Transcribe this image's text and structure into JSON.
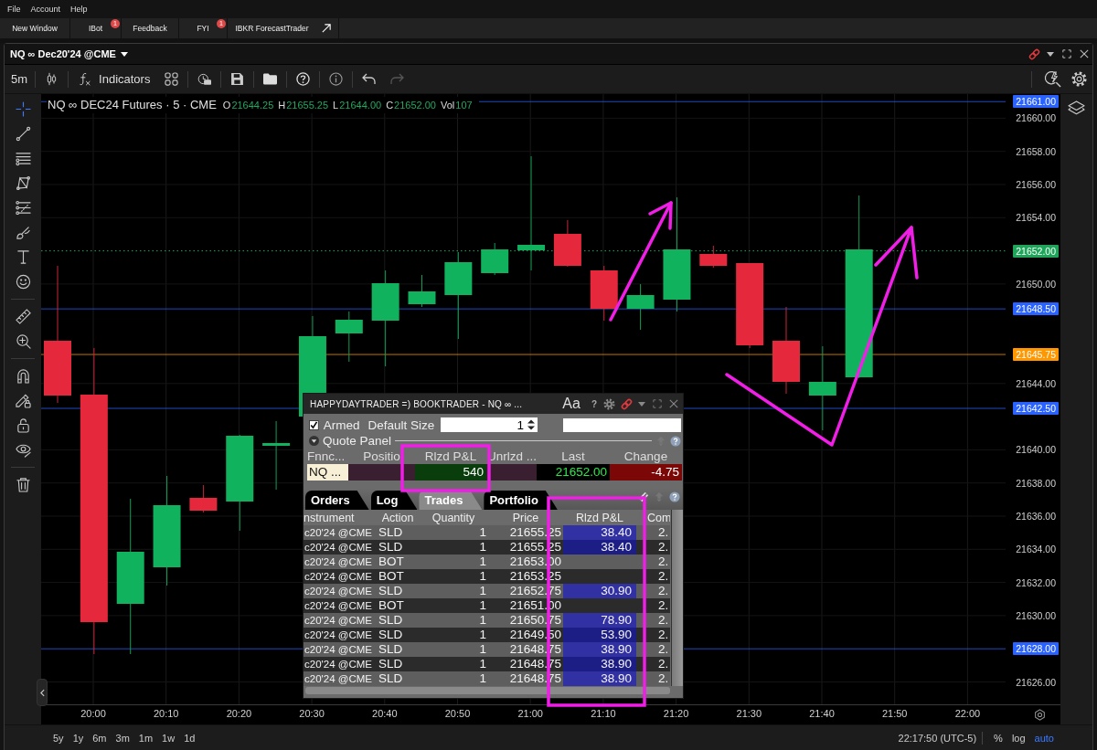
{
  "menu_bar": [
    {
      "label": "File"
    },
    {
      "label": "Account"
    },
    {
      "label": "Help"
    }
  ],
  "app_tabs": [
    {
      "label": "New Window",
      "kind": "plain"
    },
    {
      "label": "IBot",
      "kind": "plain",
      "badge": "1"
    },
    {
      "label": "Feedback",
      "kind": "plain"
    },
    {
      "label": "FYI",
      "kind": "plain",
      "badge": "1"
    },
    {
      "label": "IBKR ForecastTrader",
      "kind": "external"
    }
  ],
  "chart_window": {
    "title": "NQ ∞ Dec20'24 @CME",
    "toolbar": {
      "interval": "5m",
      "indicators": "Indicators",
      "undo": {
        "disabled": false
      },
      "redo": {
        "disabled": true
      }
    },
    "drawing_tools": [
      {
        "selected": true
      },
      {
        "selected": false
      },
      {
        "selected": false
      },
      {
        "selected": false
      },
      {
        "selected": false
      },
      {
        "selected": false
      },
      {
        "selected": false
      },
      {
        "selected": false
      },
      {
        "selected": false
      },
      {
        "selected": false
      },
      {
        "selected": false
      },
      {
        "selected": false
      },
      {
        "selected": false
      },
      {
        "selected": false
      },
      {
        "selected": false
      }
    ],
    "legend": {
      "symbol": "NQ ∞ DEC24 Futures · 5 · CME",
      "fields": [
        {
          "label": "O",
          "value": "21644.25"
        },
        {
          "label": "H",
          "value": "21655.25"
        },
        {
          "label": "L",
          "value": "21644.00"
        },
        {
          "label": "C",
          "value": "21652.00"
        },
        {
          "label": "Vol",
          "value": "107"
        }
      ]
    },
    "price_ticks": [
      "21660.00",
      "21658.00",
      "21656.00",
      "21654.00",
      "21650.00",
      "21644.00",
      "21640.00",
      "21638.00",
      "21636.00",
      "21634.00",
      "21632.00",
      "21630.00",
      "21626.00"
    ],
    "price_markers": [
      {
        "label": "21661.00",
        "color": "#2962ff",
        "kind": "level"
      },
      {
        "label": "21652.00",
        "color": "#1ea55a",
        "kind": "last"
      },
      {
        "label": "21648.50",
        "color": "#2962ff",
        "kind": "level"
      },
      {
        "label": "21645.75",
        "color": "#ff9800",
        "kind": "level"
      },
      {
        "label": "21642.50",
        "color": "#2962ff",
        "kind": "level"
      },
      {
        "label": "21628.00",
        "color": "#2962ff",
        "kind": "level"
      }
    ],
    "time_axis": [
      "20:00",
      "20:10",
      "20:20",
      "20:30",
      "20:40",
      "20:50",
      "21:00",
      "21:10",
      "21:20",
      "21:30",
      "21:40",
      "21:50",
      "22:00"
    ],
    "ranges": [
      {
        "label": "5y"
      },
      {
        "label": "1y"
      },
      {
        "label": "6m"
      },
      {
        "label": "3m"
      },
      {
        "label": "1m"
      },
      {
        "label": "1w"
      },
      {
        "label": "1d"
      }
    ],
    "status_bar": {
      "clock": "22:17:50 (UTC-5)",
      "scale_options": [
        {
          "label": "%",
          "selected": false
        },
        {
          "label": "log",
          "selected": false
        },
        {
          "label": "auto",
          "selected": true
        }
      ]
    }
  },
  "booktrader": {
    "title": "HAPPYDAYTRADER =) BOOKTRADER - NQ ∞ ...",
    "font_button": "Aa",
    "help": "?",
    "armed": {
      "label": "Armed",
      "checked": true
    },
    "default_size": {
      "label": "Default Size",
      "value": "1"
    },
    "quote_panel": {
      "title": "Quote Panel",
      "expanded": true
    },
    "quote_columns": [
      {
        "header": "Fnnc...",
        "value": "NQ ...",
        "kind": "name"
      },
      {
        "header": "Positio",
        "kind": "neutral"
      },
      {
        "header": "Rlzd P&L",
        "value": "540",
        "kind": "gain"
      },
      {
        "header": "Unrlzd ...",
        "kind": "neutral"
      },
      {
        "header": "Last",
        "value": "21652.00",
        "kind": "last"
      },
      {
        "header": "Change",
        "value": "-4.75",
        "kind": "loss"
      }
    ],
    "tabs": [
      {
        "label": "Orders",
        "selected": false
      },
      {
        "label": "Log",
        "selected": false
      },
      {
        "label": "Trades",
        "selected": true
      },
      {
        "label": "Portfolio",
        "selected": false
      }
    ],
    "trade_columns": [
      "nstrument",
      "Action",
      "Quantity",
      "Price",
      "Rlzd P&L",
      "Com"
    ],
    "trades": [
      {
        "instrument": "c20'24 @CME",
        "action": "SLD",
        "quantity": "1",
        "price": "21655.25",
        "realized_pnl": "38.40",
        "commission": "2."
      },
      {
        "instrument": "c20'24 @CME",
        "action": "SLD",
        "quantity": "1",
        "price": "21655.25",
        "realized_pnl": "38.40",
        "commission": "2."
      },
      {
        "instrument": "c20'24 @CME",
        "action": "BOT",
        "quantity": "1",
        "price": "21653.00",
        "commission": "2."
      },
      {
        "instrument": "c20'24 @CME",
        "action": "BOT",
        "quantity": "1",
        "price": "21653.25",
        "commission": "2."
      },
      {
        "instrument": "c20'24 @CME",
        "action": "SLD",
        "quantity": "1",
        "price": "21652.75",
        "realized_pnl": "30.90",
        "commission": "2."
      },
      {
        "instrument": "c20'24 @CME",
        "action": "BOT",
        "quantity": "1",
        "price": "21651.00",
        "commission": "2."
      },
      {
        "instrument": "c20'24 @CME",
        "action": "SLD",
        "quantity": "1",
        "price": "21650.75",
        "realized_pnl": "78.90",
        "commission": "2."
      },
      {
        "instrument": "c20'24 @CME",
        "action": "SLD",
        "quantity": "1",
        "price": "21649.50",
        "realized_pnl": "53.90",
        "commission": "2."
      },
      {
        "instrument": "c20'24 @CME",
        "action": "SLD",
        "quantity": "1",
        "price": "21648.75",
        "realized_pnl": "38.90",
        "commission": "2."
      },
      {
        "instrument": "c20'24 @CME",
        "action": "SLD",
        "quantity": "1",
        "price": "21648.75",
        "realized_pnl": "38.90",
        "commission": "2."
      },
      {
        "instrument": "c20'24 @CME",
        "action": "SLD",
        "quantity": "1",
        "price": "21648.75",
        "realized_pnl": "38.90",
        "commission": "2."
      }
    ]
  }
}
